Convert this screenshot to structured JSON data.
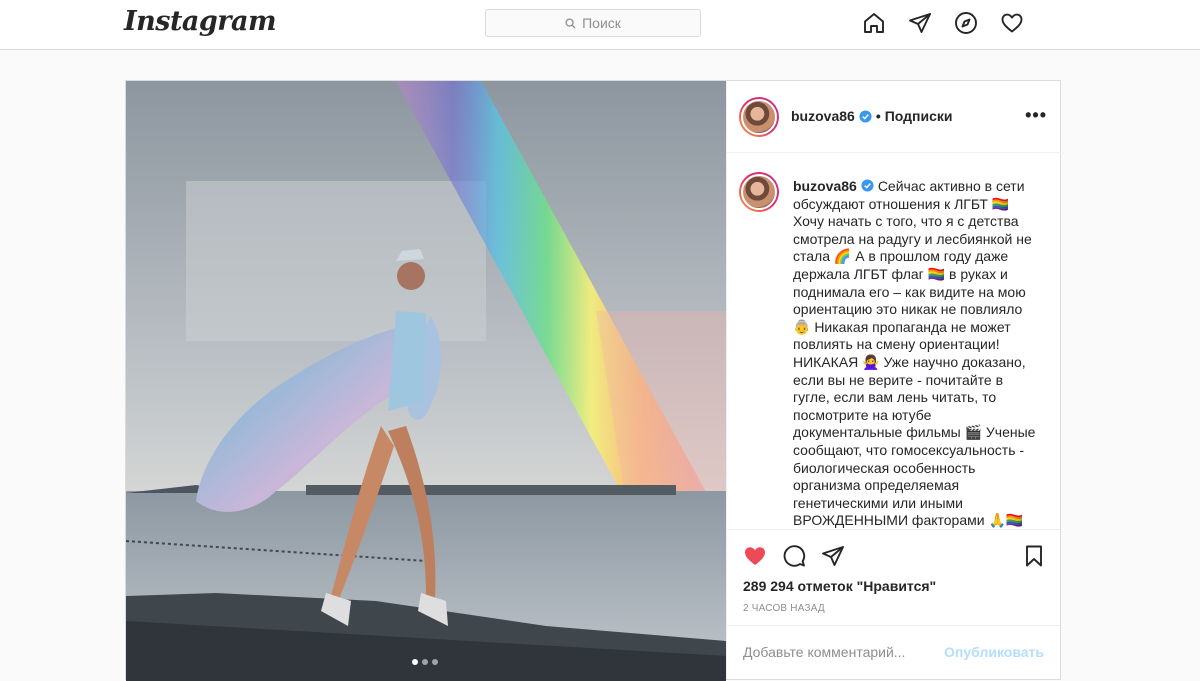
{
  "header": {
    "logo": "Instagram",
    "search_placeholder": "Поиск",
    "icons": [
      "home-icon",
      "direct-icon",
      "explore-icon",
      "activity-icon"
    ]
  },
  "post": {
    "username": "buzova86",
    "follow_label": "Подписки",
    "more_label": "•••",
    "caption_lines": [
      "Сейчас активно в сети обсуждают отношения к ЛГБТ 🏳️‍🌈 Хочу начать с того, что я с детства смотрела на радугу и лесбиянкой не стала 🌈 А в прошлом году даже держала ЛГБТ флаг 🏳️‍🌈 в руках и поднимала его – как видите на мою ориентацию это никак не повлияло 👵 Никакая пропаганда не может повлиять на смену ориентации! НИКАКАЯ 🙅‍♀️ Уже научно доказано, если вы не верите - почитайте в гугле, если вам лень читать, то посмотрите на ютубе документальные фильмы 🎬 Ученые сообщают, что гомосексуальность - биологическая особенность организма определяемая генетическими или иными ВРОЖДЕННЫМИ факторами 🙏🏳️‍🌈"
    ],
    "likes": "289 294 отметок \"Нравится\"",
    "time": "2 ЧАСОВ НАЗАД",
    "comment_placeholder": "Добавьте комментарий...",
    "publish_label": "Опубликовать",
    "carousel_dots": 3,
    "carousel_active": 1,
    "colors": {
      "like_red": "#ed4956",
      "verified_blue": "#3897f0",
      "publish_blue": "#b2dffc"
    }
  }
}
